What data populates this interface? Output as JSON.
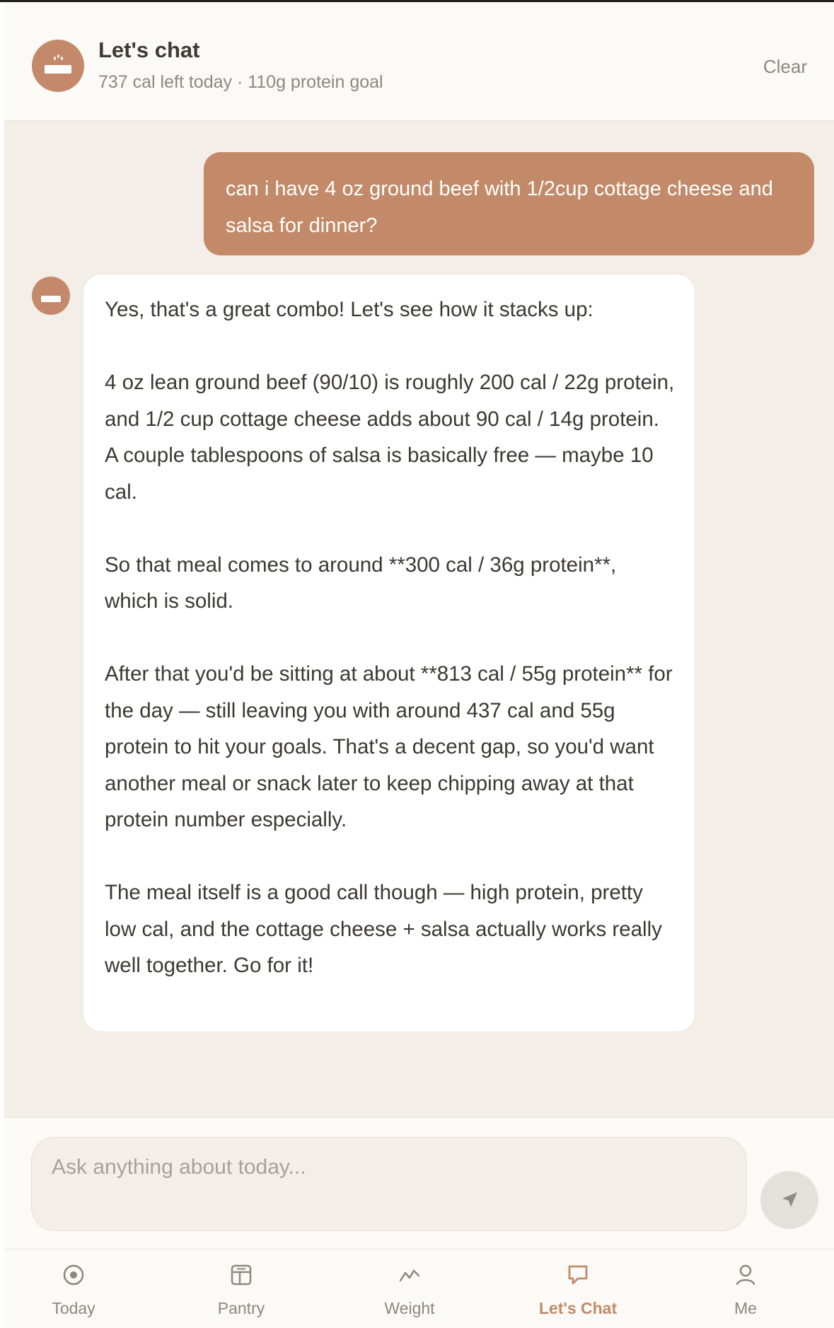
{
  "header": {
    "title": "Let's chat",
    "subtitle": "737 cal left today · 110g protein goal",
    "clear_label": "Clear",
    "avatar_icon": "bowl-icon"
  },
  "messages": {
    "user": "can i have 4 oz ground beef with 1/2cup cottage cheese and salsa for dinner?",
    "assistant": [
      "Yes, that's a great combo! Let's see how it stacks up:",
      "4 oz lean ground beef (90/10) is roughly 200 cal / 22g protein, and 1/2 cup cottage cheese adds about 90 cal / 14g protein. A couple tablespoons of salsa is basically free — maybe 10 cal.",
      "So that meal comes to around **300 cal / 36g protein**, which is solid.",
      "After that you'd be sitting at about **813 cal / 55g protein** for the day — still leaving you with around 437 cal and 55g protein to hit your goals. That's a decent gap, so you'd want another meal or snack later to keep chipping away at that protein number especially.",
      "The meal itself is a good call though — high protein, pretty low cal, and the cottage cheese + salsa actually works really well together. Go for it!"
    ]
  },
  "composer": {
    "placeholder": "Ask anything about today...",
    "send_icon": "send-icon"
  },
  "nav": {
    "items": [
      {
        "label": "Today",
        "icon": "target-icon"
      },
      {
        "label": "Pantry",
        "icon": "pantry-icon"
      },
      {
        "label": "Weight",
        "icon": "trend-icon"
      },
      {
        "label": "Let's Chat",
        "icon": "chat-bubble-icon",
        "active": true
      },
      {
        "label": "Me",
        "icon": "person-icon"
      }
    ]
  },
  "colors": {
    "accent": "#c28a68",
    "background": "#f3eee7",
    "surface": "#fcfaf6",
    "text": "#3b3835",
    "muted": "#8d8780"
  }
}
